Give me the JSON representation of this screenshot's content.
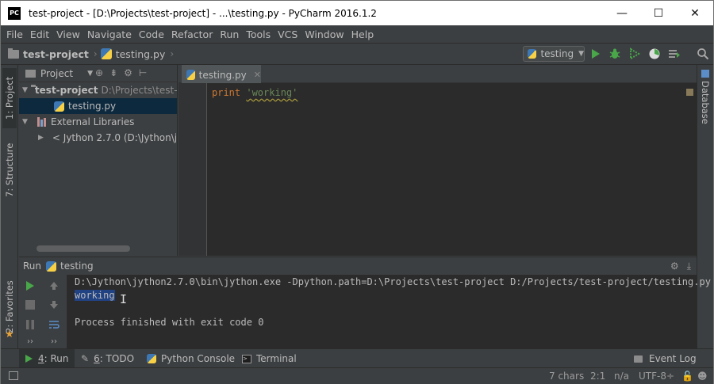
{
  "window": {
    "title": "test-project - [D:\\Projects\\test-project] - ...\\testing.py - PyCharm 2016.1.2",
    "logo_text": "PC",
    "controls": {
      "minimize": "—",
      "maximize": "☐",
      "close": "✕"
    }
  },
  "menu": [
    "File",
    "Edit",
    "View",
    "Navigate",
    "Code",
    "Refactor",
    "Run",
    "Tools",
    "VCS",
    "Window",
    "Help"
  ],
  "breadcrumb": {
    "project": "test-project",
    "file": "testing.py",
    "sep": "›"
  },
  "toolbar": {
    "run_config": "testing"
  },
  "left_stripe": {
    "project_tab": "1: Project",
    "structure_tab": "7: Structure",
    "favorites_tab": "2: Favorites"
  },
  "right_stripe": {
    "database_tab": "Database"
  },
  "project_panel": {
    "header": "Project",
    "tree": {
      "root_name": "test-project",
      "root_path": "D:\\Projects\\test-",
      "file": "testing.py",
      "external": "External Libraries",
      "jython": "< Jython 2.7.0 (D:\\Jython\\j"
    }
  },
  "editor": {
    "tab_label": "testing.py",
    "code_keyword": "print",
    "code_string": "'working'"
  },
  "run": {
    "header_label": "Run",
    "config_name": "testing",
    "console": {
      "command": "D:\\Jython\\jython2.7.0\\bin\\jython.exe -Dpython.path=D:\\Projects\\test-project D:/Projects/test-project/testing.py",
      "output": "working",
      "exit": "Process finished with exit code 0"
    }
  },
  "bottom_tabs": {
    "run": {
      "num": "4",
      "label": ": Run"
    },
    "todo": {
      "num": "6",
      "label": ": TODO"
    },
    "python_console": "Python Console",
    "terminal": "Terminal",
    "event_log": "Event Log"
  },
  "status": {
    "chars": "7 chars",
    "position": "2:1",
    "na": "n/a",
    "encoding": "UTF-8÷"
  },
  "colors": {
    "run_green": "#49a74a",
    "keyword": "#cc7832",
    "string": "#6a8759",
    "selection": "#214283"
  }
}
